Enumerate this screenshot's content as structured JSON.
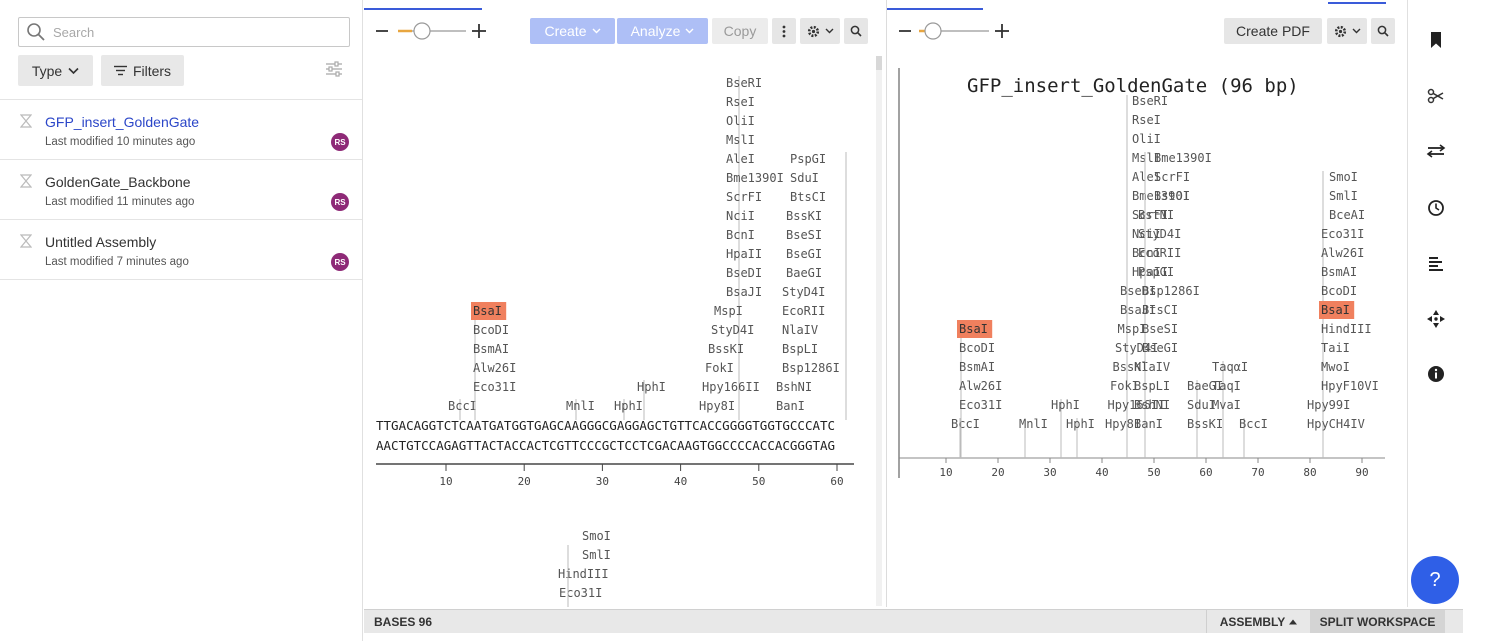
{
  "sidebar": {
    "search_placeholder": "Search",
    "type_label": "Type",
    "filters_label": "Filters",
    "documents": [
      {
        "name": "GFP_insert_GoldenGate",
        "modified": "Last modified 10 minutes ago",
        "avatar": "RS"
      },
      {
        "name": "GoldenGate_Backbone",
        "modified": "Last modified 11 minutes ago",
        "avatar": "RS"
      },
      {
        "name": "Untitled Assembly",
        "modified": "Last modified 7 minutes ago",
        "avatar": "RS"
      }
    ]
  },
  "left_toolbar": {
    "create_label": "Create",
    "analyze_label": "Analyze",
    "copy_label": "Copy"
  },
  "right_toolbar": {
    "create_pdf_label": "Create PDF"
  },
  "sequence_view": {
    "top_strand": "TTGACAGGTCTCAATGATGGTGAGCAAGGGCGAGGAGCTGTTCACCGGGGTGGTGCCCATC",
    "bottom_strand": "AACTGTCCAGAGTTACTACCACTCGTTCCCGCTCCTCGACAAGTGGCCCCACCACGGGTAG",
    "ruler_ticks": [
      "10",
      "20",
      "30",
      "40",
      "50",
      "60"
    ],
    "highlighted_enzyme": "BsaI",
    "enzyme_stacks": [
      {
        "enzymes": [
          "BccI"
        ]
      },
      {
        "enzymes": [
          "Eco31I",
          "Alw26I",
          "BsmAI",
          "BcoDI",
          "BsaI"
        ]
      },
      {
        "enzymes": [
          "MnlI"
        ]
      },
      {
        "enzymes": [
          "HphI"
        ]
      },
      {
        "enzymes": [
          "HphI"
        ]
      },
      {
        "enzymes": [
          "Hpy8I",
          "Hpy166II",
          "FokI",
          "BssKI",
          "StyD4I",
          "MspI",
          "BsaJI",
          "BseDI",
          "HpaII",
          "BcnI",
          "NciI",
          "ScrFI",
          "Bme1390I",
          "AleI",
          "MslI",
          "OliI",
          "RseI",
          "BseRI"
        ]
      },
      {
        "enzymes": [
          "BanI",
          "BshNI",
          "Bsp1286I",
          "BspLI",
          "NlaIV",
          "EcoRII",
          "StyD4I",
          "BaeGI",
          "BseGI",
          "BseSI",
          "BssKI",
          "BtsCI",
          "SduI",
          "PspGI"
        ]
      }
    ],
    "lower_stack": [
      "SmoI",
      "SmlI",
      "HindIII",
      "Eco31I"
    ]
  },
  "linear_map": {
    "title": "GFP_insert_GoldenGate (96 bp)",
    "axis_ticks": [
      "10",
      "20",
      "30",
      "40",
      "50",
      "60",
      "70",
      "80",
      "90"
    ],
    "highlighted_enzyme": "BsaI",
    "enzyme_stacks": [
      {
        "enzymes": [
          "BccI"
        ]
      },
      {
        "enzymes": [
          "Eco31I",
          "Alw26I",
          "BsmAI",
          "BcoDI",
          "BsaI"
        ]
      },
      {
        "enzymes": [
          "MnlI"
        ]
      },
      {
        "enzymes": [
          "HphI"
        ]
      },
      {
        "enzymes": [
          "HphI"
        ]
      },
      {
        "enzymes": [
          "Hpy8I",
          "Hpy166II",
          "FokI",
          "BssKI",
          "StyD4I",
          "MspI",
          "BsaJI",
          "BseDI",
          "HpaII",
          "BcnI",
          "NciI",
          "ScrFI",
          "Bme1390I",
          "AleI",
          "MslI",
          "OliI",
          "RseI",
          "BseRI"
        ]
      },
      {
        "enzymes": [
          "BanI",
          "BshNI",
          "BspLI",
          "NlaIV",
          "BseGI",
          "BseSI",
          "BtsCI",
          "Bsp1286I",
          "PspGI",
          "EcoRII",
          "StyD4I",
          "BstNI",
          "BstOI",
          "ScrFI",
          "Bme1390I"
        ]
      },
      {
        "enzymes": [
          "BssKI",
          "SduI",
          "BaeGI"
        ]
      },
      {
        "enzymes": [
          "MvaI",
          "TaqI",
          "TaqαI"
        ]
      },
      {
        "enzymes": [
          "BccI"
        ]
      },
      {
        "enzymes": [
          "HpyCH4IV",
          "Hpy99I",
          "HpyF10VI",
          "MwoI",
          "TaiI",
          "HindIII",
          "BsaI",
          "BcoDI",
          "BsmAI",
          "Alw26I",
          "Eco31I",
          "BceAI",
          "SmlI",
          "SmoI"
        ]
      }
    ]
  },
  "status": {
    "bases": "BASES 96",
    "assembly": "ASSEMBLY",
    "split_workspace": "SPLIT WORKSPACE"
  },
  "rail_icons": [
    "bookmark-icon",
    "scissors-icon",
    "transfer-icon",
    "history-icon",
    "align-icon",
    "crosshair-icon",
    "info-icon"
  ],
  "colors": {
    "accent": "#3a5bd9",
    "highlight": "#f0805e",
    "help_button": "#2f5fe7"
  }
}
